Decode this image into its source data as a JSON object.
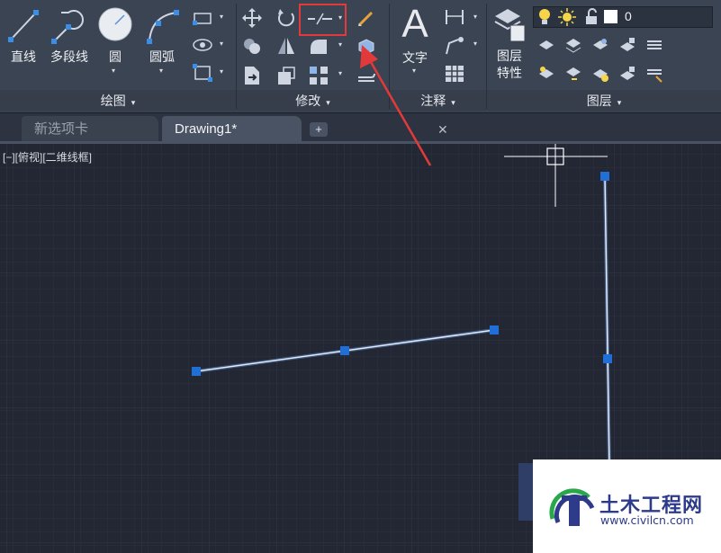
{
  "ribbon": {
    "draw_panel": {
      "title": "绘图",
      "tools": [
        {
          "label": "直线",
          "icon": "line-icon"
        },
        {
          "label": "多段线",
          "icon": "polyline-icon"
        },
        {
          "label": "圆",
          "icon": "circle-icon"
        },
        {
          "label": "圆弧",
          "icon": "arc-icon"
        }
      ]
    },
    "modify_panel": {
      "title": "修改",
      "highlighted_tool": "break-icon"
    },
    "annotation_panel": {
      "title": "注释",
      "text_label": "文字",
      "text_icon_glyph": "A"
    },
    "layers_panel": {
      "title": "图层",
      "properties_label_1": "图层",
      "properties_label_2": "特性",
      "current_layer": "0"
    }
  },
  "tabs": [
    {
      "label": "新选项卡",
      "active": false
    },
    {
      "label": "Drawing1*",
      "active": true
    }
  ],
  "tab_close_glyph": "✕",
  "tab_add_glyph": "+",
  "viewport_label": "[−][俯视][二维线框]",
  "watermark": {
    "title": "土木工程网",
    "url": "www.civilcn.com"
  },
  "colors": {
    "ribbon_bg": "#3b4453",
    "canvas_bg": "#222733",
    "grip_blue": "#1f6fd6",
    "highlight_red": "#e23a3a"
  }
}
